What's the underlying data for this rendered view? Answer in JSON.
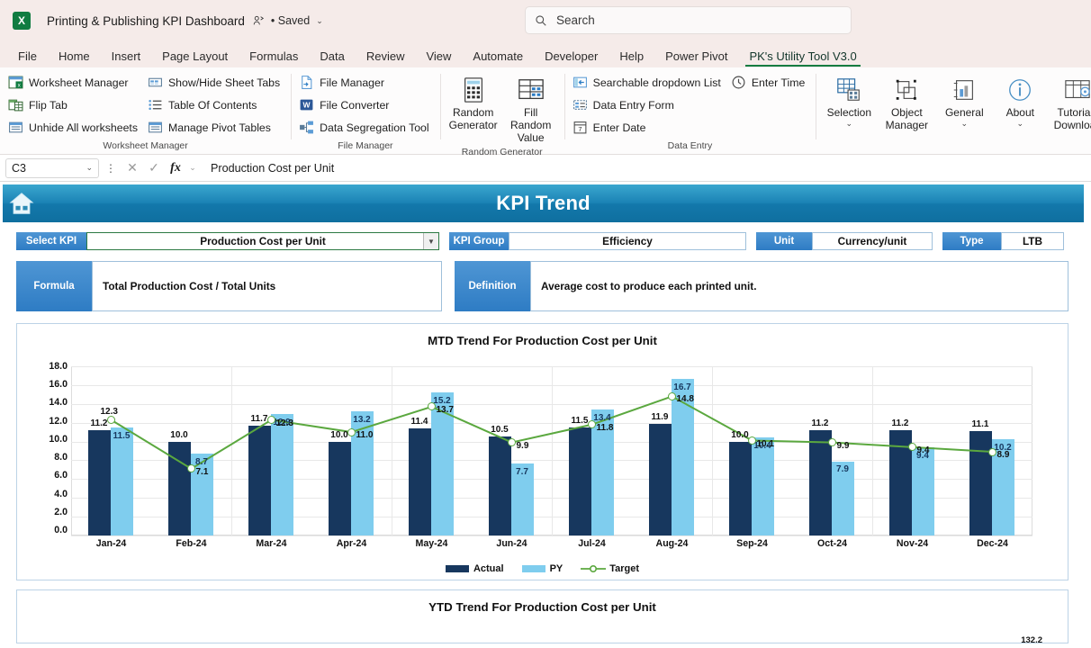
{
  "titlebar": {
    "app_icon": "excel-logo",
    "document_title": "Printing & Publishing KPI Dashboard",
    "shared_icon": "person-share-icon",
    "saved_status": "• Saved",
    "saved_chevron": "⌄",
    "search_placeholder": "Search",
    "search_icon": "search-icon"
  },
  "tabs": [
    {
      "label": "File",
      "active": false
    },
    {
      "label": "Home",
      "active": false
    },
    {
      "label": "Insert",
      "active": false
    },
    {
      "label": "Page Layout",
      "active": false
    },
    {
      "label": "Formulas",
      "active": false
    },
    {
      "label": "Data",
      "active": false
    },
    {
      "label": "Review",
      "active": false
    },
    {
      "label": "View",
      "active": false
    },
    {
      "label": "Automate",
      "active": false
    },
    {
      "label": "Developer",
      "active": false
    },
    {
      "label": "Help",
      "active": false
    },
    {
      "label": "Power Pivot",
      "active": false
    },
    {
      "label": "PK's Utility Tool V3.0",
      "active": true
    }
  ],
  "ribbon": {
    "groups": [
      {
        "name": "Worksheet Manager",
        "label": "Worksheet Manager",
        "col1": [
          {
            "label": "Worksheet Manager",
            "icon": "worksheet-manager-icon"
          },
          {
            "label": "Flip Tab",
            "icon": "flip-tab-icon"
          },
          {
            "label": "Unhide All worksheets",
            "icon": "unhide-sheets-icon"
          }
        ],
        "col2": [
          {
            "label": "Show/Hide Sheet Tabs",
            "icon": "show-hide-tabs-icon"
          },
          {
            "label": "Table Of Contents",
            "icon": "table-of-contents-icon"
          },
          {
            "label": "Manage Pivot Tables",
            "icon": "manage-pivot-tables-icon"
          }
        ]
      },
      {
        "name": "File Manager",
        "label": "File Manager",
        "col1": [
          {
            "label": "File Manager",
            "icon": "file-manager-icon"
          },
          {
            "label": "File Converter",
            "icon": "file-converter-icon"
          },
          {
            "label": "Data Segregation Tool",
            "icon": "data-segregation-icon"
          }
        ]
      },
      {
        "name": "Random Generator",
        "label": "Random Generator",
        "big": [
          {
            "label": "Random Generator",
            "icon": "random-generator-icon"
          },
          {
            "label": "Fill Random Value",
            "icon": "fill-random-value-icon"
          }
        ]
      },
      {
        "name": "Data Entry",
        "label": "Data Entry",
        "col1": [
          {
            "label": "Searchable dropdown List",
            "icon": "searchable-dropdown-icon"
          },
          {
            "label": "Data Entry Form",
            "icon": "data-entry-form-icon"
          },
          {
            "label": "Enter Date",
            "icon": "enter-date-icon"
          }
        ],
        "col2": [
          {
            "label": "Enter Time",
            "icon": "enter-time-icon"
          }
        ]
      },
      {
        "name": "Utility Buttons",
        "label": "",
        "big": [
          {
            "label": "Selection",
            "icon": "selection-icon",
            "chevron": "⌄"
          },
          {
            "label": "Object Manager",
            "icon": "object-manager-icon",
            "chevron": "⌄"
          },
          {
            "label": "General",
            "icon": "general-icon",
            "chevron": "⌄"
          },
          {
            "label": "About",
            "icon": "about-icon",
            "chevron": "⌄"
          },
          {
            "label": "Tutorials Download",
            "icon": "tutorials-download-icon",
            "chevron": ""
          }
        ]
      }
    ]
  },
  "formula_bar": {
    "name_box": "C3",
    "name_box_chevron": "⌄",
    "menu_icon": "⋮",
    "cancel_icon": "✕",
    "confirm_icon": "✓",
    "fx_label": "fx",
    "fx_chevron": "⌄",
    "formula_value": "Production Cost per Unit"
  },
  "dashboard": {
    "home_icon": "home-icon",
    "header_title": "KPI Trend",
    "select_kpi": {
      "label": "Select KPI",
      "value": "Production Cost per Unit",
      "dropdown_icon": "chevron-down-icon"
    },
    "kpi_group": {
      "label": "KPI Group",
      "value": "Efficiency"
    },
    "unit": {
      "label": "Unit",
      "value": "Currency/unit"
    },
    "type": {
      "label": "Type",
      "value": "LTB"
    },
    "formula": {
      "label": "Formula",
      "value": "Total Production Cost / Total Units"
    },
    "definition": {
      "label": "Definition",
      "value": "Average cost to produce each printed unit."
    }
  },
  "ytd": {
    "title": "YTD Trend For Production Cost per Unit",
    "peek_label": "132.2"
  },
  "chart_data": {
    "type": "bar",
    "title": "MTD Trend For Production Cost per Unit",
    "xlabel": "",
    "ylabel": "",
    "ylim": [
      0,
      18
    ],
    "ytick_labels": [
      "18.0",
      "16.0",
      "14.0",
      "12.0",
      "10.0",
      "8.0",
      "6.0",
      "4.0",
      "2.0",
      "0.0"
    ],
    "grid": true,
    "legend_position": "bottom",
    "categories": [
      "Jan-24",
      "Feb-24",
      "Mar-24",
      "Apr-24",
      "May-24",
      "Jun-24",
      "Jul-24",
      "Aug-24",
      "Sep-24",
      "Oct-24",
      "Nov-24",
      "Dec-24"
    ],
    "series": [
      {
        "name": "Actual",
        "type": "bar",
        "color": "#17375e",
        "values": [
          11.2,
          10.0,
          11.7,
          10.0,
          11.4,
          10.5,
          11.5,
          11.9,
          10.0,
          11.2,
          11.2,
          11.1
        ]
      },
      {
        "name": "PY",
        "type": "bar",
        "color": "#7fcdee",
        "values": [
          11.5,
          8.7,
          12.9,
          13.2,
          15.2,
          7.7,
          13.4,
          16.7,
          10.4,
          7.9,
          9.4,
          10.2
        ]
      },
      {
        "name": "Target",
        "type": "line",
        "color": "#5ba83f",
        "values": [
          12.3,
          7.1,
          12.3,
          11.0,
          13.7,
          9.9,
          11.8,
          14.8,
          10.1,
          9.9,
          9.4,
          8.9
        ]
      }
    ]
  }
}
